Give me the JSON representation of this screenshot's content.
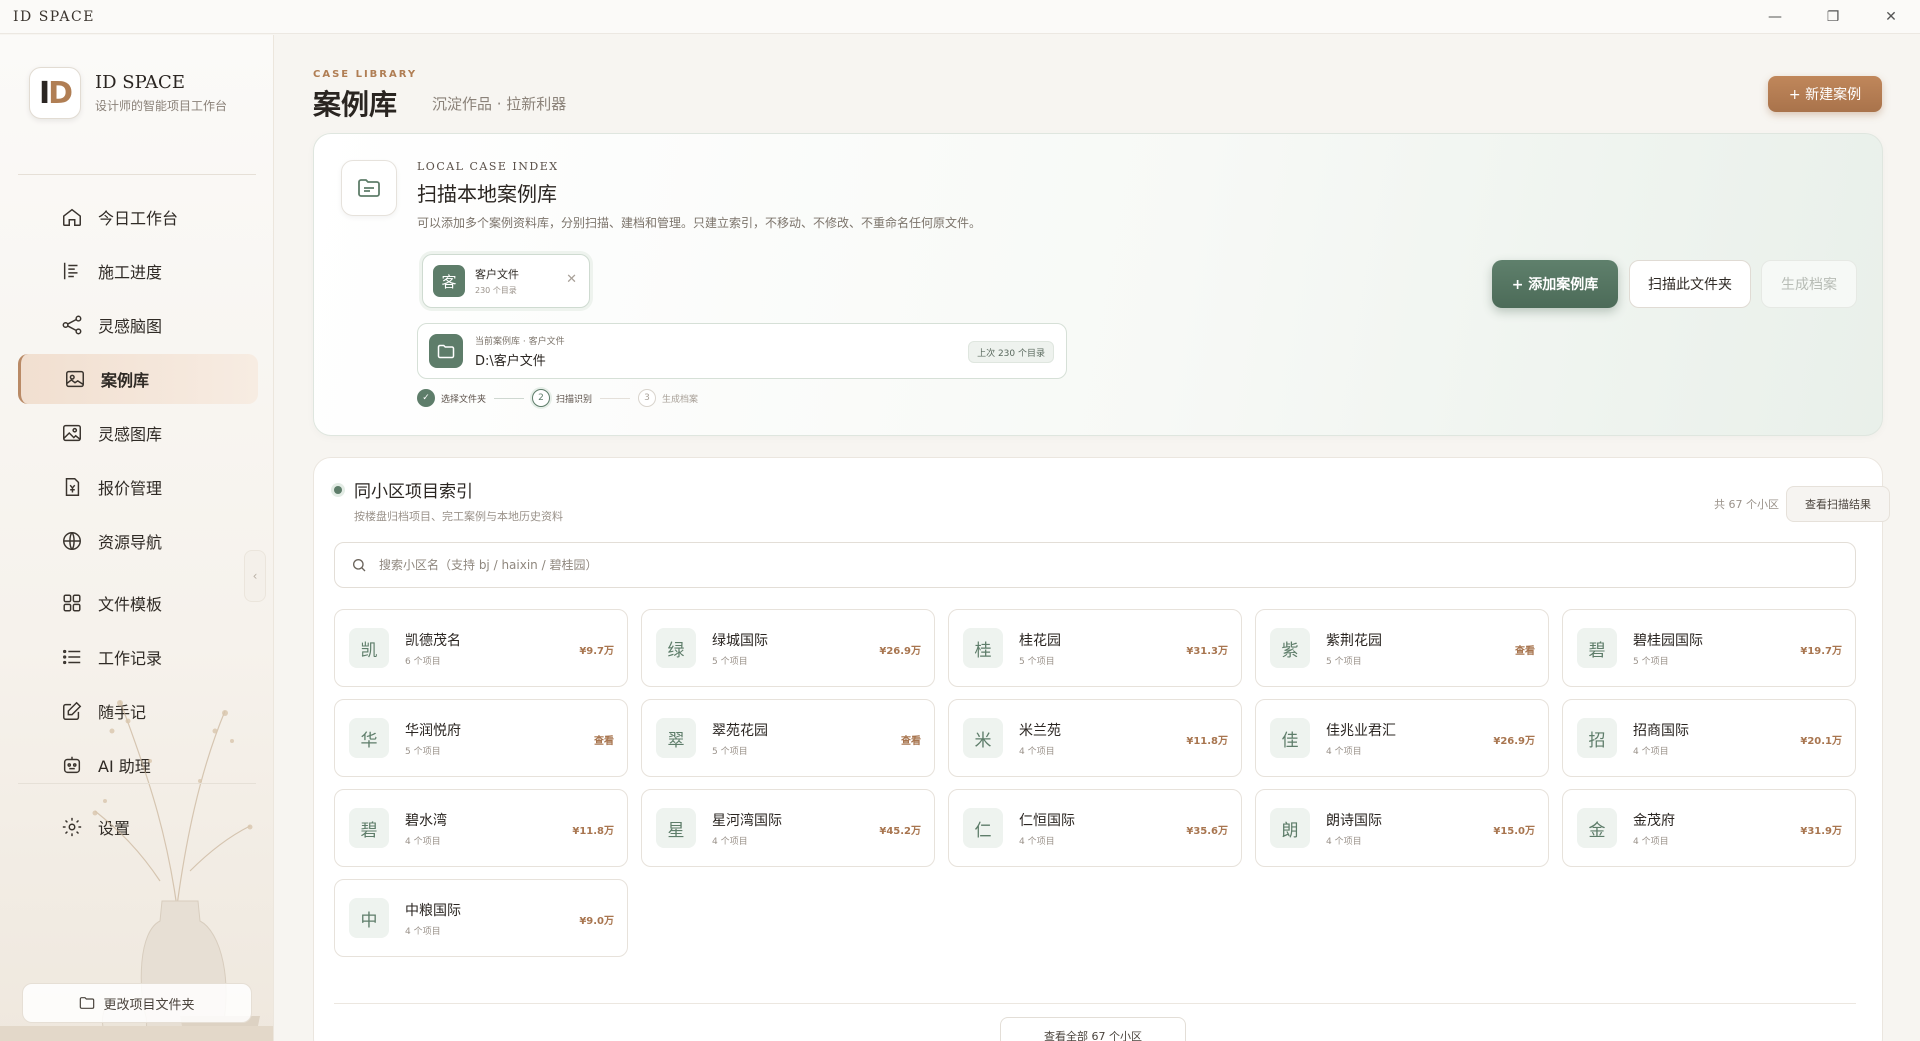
{
  "window": {
    "title": "ID SPACE",
    "controls": [
      "—",
      "❐",
      "✕"
    ]
  },
  "brand": {
    "logo_i": "I",
    "logo_d": "D",
    "name": "ID SPACE",
    "tagline": "设计师的智能项目工作台"
  },
  "sidebar": {
    "items": [
      {
        "label": "今日工作台",
        "icon": "home-icon"
      },
      {
        "label": "施工进度",
        "icon": "progress-icon"
      },
      {
        "label": "灵感脑图",
        "icon": "mindmap-icon"
      },
      {
        "label": "案例库",
        "icon": "gallery-icon",
        "active": true
      },
      {
        "label": "灵感图库",
        "icon": "image-icon"
      },
      {
        "label": "报价管理",
        "icon": "quote-icon"
      },
      {
        "label": "资源导航",
        "icon": "globe-icon"
      },
      {
        "label": "文件模板",
        "icon": "grid-icon"
      },
      {
        "label": "工作记录",
        "icon": "list-icon"
      },
      {
        "label": "随手记",
        "icon": "note-icon"
      },
      {
        "label": "AI 助理",
        "icon": "robot-icon"
      },
      {
        "label": "设置",
        "icon": "gear-icon"
      }
    ],
    "collapse_glyph": "‹",
    "change_folder_label": "更改项目文件夹"
  },
  "header": {
    "eyebrow": "CASE LIBRARY",
    "title": "案例库",
    "subtitle": "沉淀作品 · 拉新利器",
    "new_case_label": "+ 新建案例"
  },
  "scan": {
    "eyebrow": "LOCAL CASE INDEX",
    "title": "扫描本地案例库",
    "description": "可以添加多个案例资料库，分别扫描、建档和管理。只建立索引，不移动、不修改、不重命名任何原文件。",
    "library_chip": {
      "avatar": "客",
      "name": "客户文件",
      "count": "230 个目录",
      "remove": "✕"
    },
    "current": {
      "label": "当前案例库 · 客户文件",
      "path": "D:\\客户文件",
      "badge": "上次 230 个目录"
    },
    "steps": [
      {
        "num": "✓",
        "label": "选择文件夹"
      },
      {
        "num": "2",
        "label": "扫描识别"
      },
      {
        "num": "3",
        "label": "生成档案"
      }
    ],
    "add_library_label": "+ 添加案例库",
    "scan_folder_label": "扫描此文件夹",
    "generate_label": "生成档案"
  },
  "index": {
    "title": "同小区项目索引",
    "subtitle": "按楼盘归档项目、完工案例与本地历史资料",
    "total": "共 67 个小区",
    "view_results_label": "查看扫描结果",
    "search_placeholder": "搜索小区名（支持 bj / haixin / 碧桂园）",
    "communities": [
      {
        "char": "凯",
        "name": "凯德茂名",
        "count": "6 个项目",
        "value": "¥9.7万"
      },
      {
        "char": "绿",
        "name": "绿城国际",
        "count": "5 个项目",
        "value": "¥26.9万"
      },
      {
        "char": "桂",
        "name": "桂花园",
        "count": "5 个项目",
        "value": "¥31.3万"
      },
      {
        "char": "紫",
        "name": "紫荆花园",
        "count": "5 个项目",
        "value": "查看"
      },
      {
        "char": "碧",
        "name": "碧桂园国际",
        "count": "5 个项目",
        "value": "¥19.7万"
      },
      {
        "char": "华",
        "name": "华润悦府",
        "count": "5 个项目",
        "value": "查看"
      },
      {
        "char": "翠",
        "name": "翠苑花园",
        "count": "5 个项目",
        "value": "查看"
      },
      {
        "char": "米",
        "name": "米兰苑",
        "count": "4 个项目",
        "value": "¥11.8万"
      },
      {
        "char": "佳",
        "name": "佳兆业君汇",
        "count": "4 个项目",
        "value": "¥26.9万"
      },
      {
        "char": "招",
        "name": "招商国际",
        "count": "4 个项目",
        "value": "¥20.1万"
      },
      {
        "char": "碧",
        "name": "碧水湾",
        "count": "4 个项目",
        "value": "¥11.8万"
      },
      {
        "char": "星",
        "name": "星河湾国际",
        "count": "4 个项目",
        "value": "¥45.2万"
      },
      {
        "char": "仁",
        "name": "仁恒国际",
        "count": "4 个项目",
        "value": "¥35.6万"
      },
      {
        "char": "朗",
        "name": "朗诗国际",
        "count": "4 个项目",
        "value": "¥15.0万"
      },
      {
        "char": "金",
        "name": "金茂府",
        "count": "4 个项目",
        "value": "¥31.9万"
      },
      {
        "char": "中",
        "name": "中粮国际",
        "count": "4 个项目",
        "value": "¥9.0万"
      }
    ],
    "view_all_label": "查看全部 67 个小区"
  },
  "colors": {
    "accent_green": "#5e7d6a",
    "accent_brown": "#b07e54",
    "background": "#f7f5f1"
  }
}
